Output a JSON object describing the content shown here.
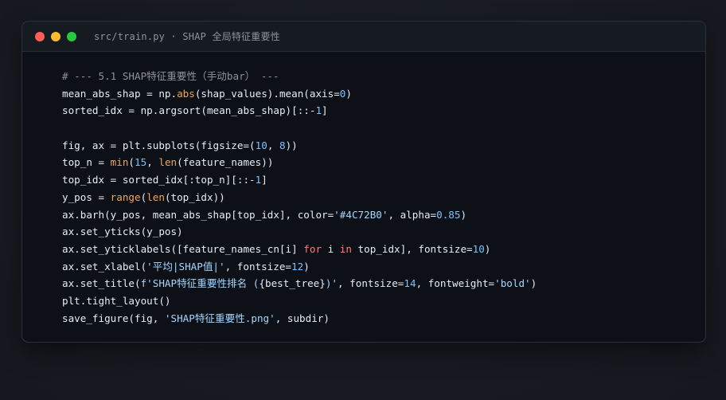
{
  "window": {
    "title": "src/train.py · SHAP 全局特征重要性"
  },
  "code": {
    "lines": [
      [
        {
          "t": "# --- 5.1 SHAP特征重要性（手动bar） ---",
          "c": "com"
        }
      ],
      [
        {
          "t": "mean_abs_shap = np.",
          "c": "plain"
        },
        {
          "t": "abs",
          "c": "fn"
        },
        {
          "t": "(shap_values).mean(axis=",
          "c": "plain"
        },
        {
          "t": "0",
          "c": "num"
        },
        {
          "t": ")",
          "c": "plain"
        }
      ],
      [
        {
          "t": "sorted_idx = np.argsort(mean_abs_shap)[::-",
          "c": "plain"
        },
        {
          "t": "1",
          "c": "num"
        },
        {
          "t": "]",
          "c": "plain"
        }
      ],
      [],
      [
        {
          "t": "fig, ax = plt.subplots(figsize=(",
          "c": "plain"
        },
        {
          "t": "10",
          "c": "num"
        },
        {
          "t": ", ",
          "c": "plain"
        },
        {
          "t": "8",
          "c": "num"
        },
        {
          "t": "))",
          "c": "plain"
        }
      ],
      [
        {
          "t": "top_n = ",
          "c": "plain"
        },
        {
          "t": "min",
          "c": "fn"
        },
        {
          "t": "(",
          "c": "plain"
        },
        {
          "t": "15",
          "c": "num"
        },
        {
          "t": ", ",
          "c": "plain"
        },
        {
          "t": "len",
          "c": "fn"
        },
        {
          "t": "(feature_names))",
          "c": "plain"
        }
      ],
      [
        {
          "t": "top_idx = sorted_idx[:top_n][::-",
          "c": "plain"
        },
        {
          "t": "1",
          "c": "num"
        },
        {
          "t": "]",
          "c": "plain"
        }
      ],
      [
        {
          "t": "y_pos = ",
          "c": "plain"
        },
        {
          "t": "range",
          "c": "fn"
        },
        {
          "t": "(",
          "c": "plain"
        },
        {
          "t": "len",
          "c": "fn"
        },
        {
          "t": "(top_idx))",
          "c": "plain"
        }
      ],
      [
        {
          "t": "ax.barh(y_pos, mean_abs_shap[top_idx], color=",
          "c": "plain"
        },
        {
          "t": "'#4C72B0'",
          "c": "str"
        },
        {
          "t": ", alpha=",
          "c": "plain"
        },
        {
          "t": "0.85",
          "c": "num"
        },
        {
          "t": ")",
          "c": "plain"
        }
      ],
      [
        {
          "t": "ax.set_yticks(y_pos)",
          "c": "plain"
        }
      ],
      [
        {
          "t": "ax.set_yticklabels([feature_names_cn[i] ",
          "c": "plain"
        },
        {
          "t": "for",
          "c": "kw"
        },
        {
          "t": " i ",
          "c": "plain"
        },
        {
          "t": "in",
          "c": "kw"
        },
        {
          "t": " top_idx], fontsize=",
          "c": "plain"
        },
        {
          "t": "10",
          "c": "num"
        },
        {
          "t": ")",
          "c": "plain"
        }
      ],
      [
        {
          "t": "ax.set_xlabel(",
          "c": "plain"
        },
        {
          "t": "'平均|SHAP值|'",
          "c": "str"
        },
        {
          "t": ", fontsize=",
          "c": "plain"
        },
        {
          "t": "12",
          "c": "num"
        },
        {
          "t": ")",
          "c": "plain"
        }
      ],
      [
        {
          "t": "ax.set_title(",
          "c": "plain"
        },
        {
          "t": "f'SHAP特征重要性排名 (",
          "c": "str"
        },
        {
          "t": "{best_tree}",
          "c": "plain"
        },
        {
          "t": ")'",
          "c": "str"
        },
        {
          "t": ", fontsize=",
          "c": "plain"
        },
        {
          "t": "14",
          "c": "num"
        },
        {
          "t": ", fontweight=",
          "c": "plain"
        },
        {
          "t": "'bold'",
          "c": "str"
        },
        {
          "t": ")",
          "c": "plain"
        }
      ],
      [
        {
          "t": "plt.tight_layout()",
          "c": "plain"
        }
      ],
      [
        {
          "t": "save_figure(fig, ",
          "c": "plain"
        },
        {
          "t": "'SHAP特征重要性.png'",
          "c": "str"
        },
        {
          "t": ", subdir)",
          "c": "plain"
        }
      ]
    ]
  },
  "colors": {
    "background": "#181b22",
    "window": "#0d1117",
    "titlebar": "#161b22",
    "comment": "#8b949e",
    "builtin": "#f0a55b",
    "number": "#79c0ff",
    "string": "#a5d6ff",
    "keyword": "#ff7b72",
    "text": "#e6edf3",
    "close_dot": "#ff5f57",
    "minimize_dot": "#febc2e",
    "maximize_dot": "#28c840"
  }
}
